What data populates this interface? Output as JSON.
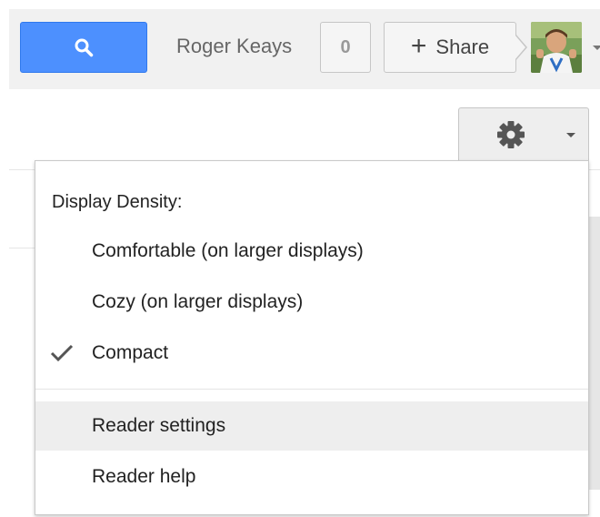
{
  "header": {
    "user_name": "Roger Keays",
    "notification_count": "0",
    "share_label": "Share",
    "accent_color": "#4d90fe",
    "search_icon": "search-icon",
    "share_icon": "plus-icon",
    "avatar_icon": "user-avatar"
  },
  "settings": {
    "gear_icon": "gear-icon",
    "caret_icon": "chevron-down-icon"
  },
  "menu": {
    "heading": "Display Density:",
    "density_options": [
      {
        "label": "Comfortable (on larger displays)",
        "checked": false
      },
      {
        "label": "Cozy (on larger displays)",
        "checked": false
      },
      {
        "label": "Compact",
        "checked": true
      }
    ],
    "actions": [
      {
        "label": "Reader settings",
        "highlighted": true
      },
      {
        "label": "Reader help",
        "highlighted": false
      }
    ]
  }
}
